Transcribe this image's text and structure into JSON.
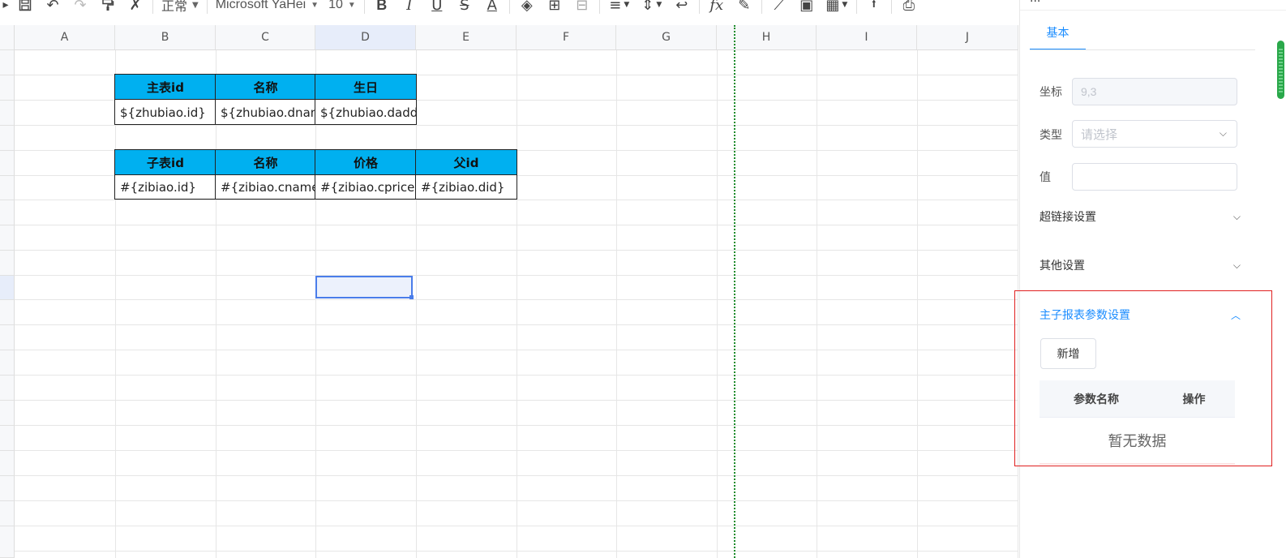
{
  "toolbar": {
    "style_value": "正常",
    "font_value": "Microsoft YaHei",
    "size_value": "10",
    "icons": [
      "preview-icon",
      "save-icon",
      "undo-icon",
      "redo-icon",
      "format-painter-icon",
      "clear-format-icon",
      "bold-icon",
      "italic-icon",
      "underline-icon",
      "strikethrough-icon",
      "font-color-icon",
      "fill-color-icon",
      "border-icon",
      "merge-cells-icon",
      "align-icon",
      "vertical-align-icon",
      "wrap-text-icon",
      "function-icon",
      "formula-icon",
      "chart-icon",
      "image-icon",
      "qrcode-icon",
      "upload-icon",
      "print-icon"
    ]
  },
  "sheet": {
    "columns": [
      "A",
      "B",
      "C",
      "D",
      "E",
      "F",
      "G",
      "H",
      "I",
      "J"
    ],
    "active_column": "D",
    "table1": {
      "headers": [
        "主表id",
        "名称",
        "生日"
      ],
      "row": [
        "${zhubiao.id}",
        "${zhubiao.dname}",
        "${zhubiao.dadd}"
      ]
    },
    "table2": {
      "headers": [
        "子表id",
        "名称",
        "价格",
        "父id"
      ],
      "row": [
        "#{zibiao.id}",
        "#{zibiao.cname}",
        "#{zibiao.cprice}",
        "#{zibiao.did}"
      ]
    },
    "colors": {
      "header_fill": "#00b0f0",
      "selection": "#4a7dea",
      "print_border": "#1a8b2a"
    }
  },
  "panel": {
    "title": "...",
    "tab_basic": "基本",
    "coord_label": "坐标",
    "coord_value": "9,3",
    "type_label": "类型",
    "type_placeholder": "请选择",
    "value_label": "值",
    "value_value": "",
    "hyperlink_label": "超链接设置",
    "other_label": "其他设置",
    "master_sub_label": "主子报表参数设置",
    "add_button": "新增",
    "param_columns": [
      "参数名称",
      "操作"
    ],
    "empty_text": "暂无数据",
    "accent": "#1a8cff",
    "highlight_border": "#e02020"
  }
}
